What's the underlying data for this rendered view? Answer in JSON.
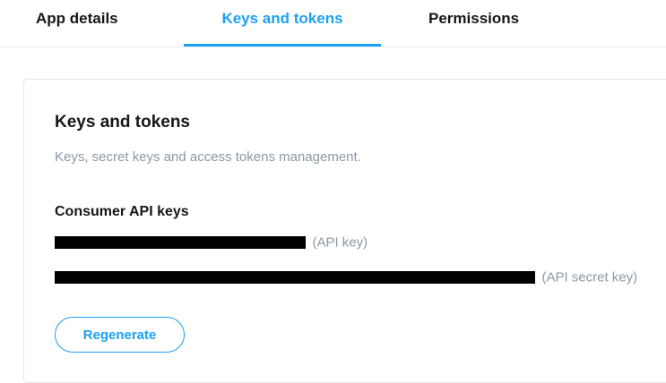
{
  "tabs": [
    {
      "label": "App details",
      "active": false
    },
    {
      "label": "Keys and tokens",
      "active": true
    },
    {
      "label": "Permissions",
      "active": false
    }
  ],
  "colors": {
    "accent": "#1da1f2",
    "text": "#14171a",
    "muted": "#8899a6",
    "border": "#e1e8ed",
    "redaction": "#000000"
  },
  "card": {
    "title": "Keys and tokens",
    "subtitle": "Keys, secret keys and access tokens management.",
    "consumer_section": {
      "title": "Consumer API keys",
      "api_key_label": "(API key)",
      "api_secret_label": "(API secret key)"
    },
    "regenerate_label": "Regenerate"
  }
}
